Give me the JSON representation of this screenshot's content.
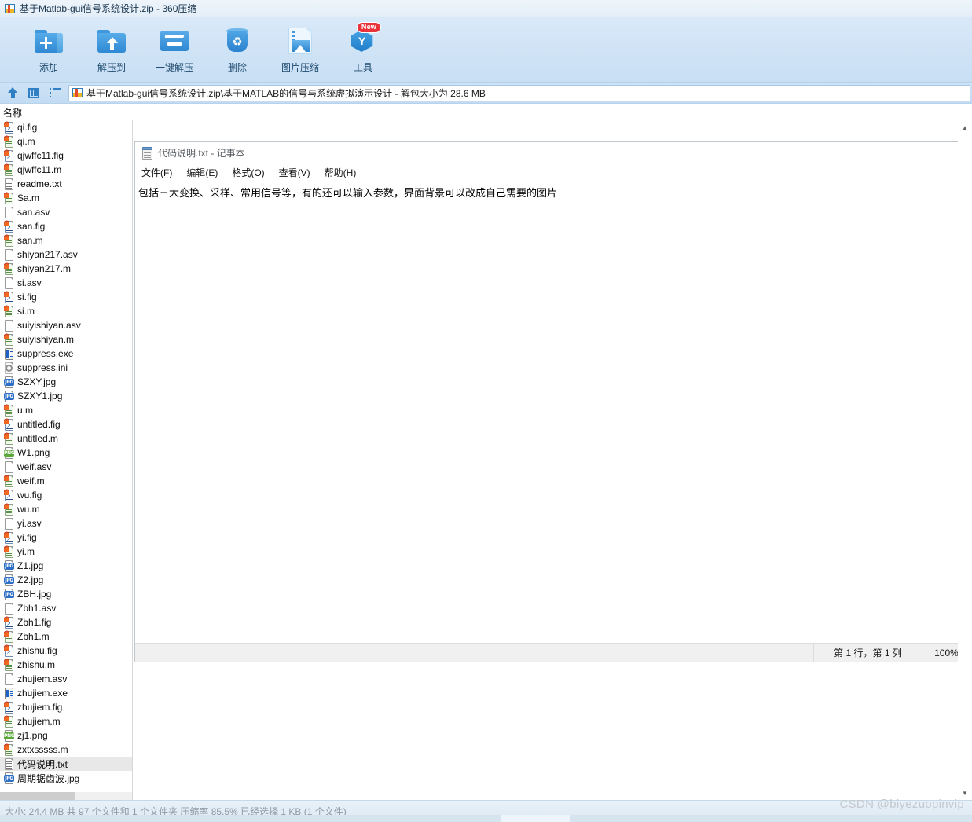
{
  "window": {
    "title": "基于Matlab-gui信号系统设计.zip - 360压缩",
    "icon": "zip-archive-icon"
  },
  "toolbar": {
    "buttons": [
      {
        "label": "添加",
        "icon": "folder-plus-icon",
        "badge": ""
      },
      {
        "label": "解压到",
        "icon": "folder-up-arrow-icon",
        "badge": ""
      },
      {
        "label": "一键解压",
        "icon": "one-click-extract-icon",
        "badge": ""
      },
      {
        "label": "删除",
        "icon": "recycle-bin-icon",
        "badge": ""
      },
      {
        "label": "图片压缩",
        "icon": "image-compress-icon",
        "badge": ""
      },
      {
        "label": "工具",
        "icon": "tools-hexagon-icon",
        "badge": "New"
      }
    ]
  },
  "addressbar": {
    "nav_icons": [
      "up-arrow-icon",
      "preview-panel-icon",
      "list-view-icon"
    ],
    "path": "基于Matlab-gui信号系统设计.zip\\基于MATLAB的信号与系统虚拟演示设计 - 解包大小为 28.6 MB"
  },
  "filelist": {
    "column_header": "名称",
    "items": [
      {
        "name": "qi.fig",
        "type": "fig",
        "selected": false
      },
      {
        "name": "qi.m",
        "type": "m",
        "selected": false
      },
      {
        "name": "qjwffc11.fig",
        "type": "fig",
        "selected": false
      },
      {
        "name": "qjwffc11.m",
        "type": "m",
        "selected": false
      },
      {
        "name": "readme.txt",
        "type": "txt",
        "selected": false
      },
      {
        "name": "Sa.m",
        "type": "m",
        "selected": false
      },
      {
        "name": "san.asv",
        "type": "asv",
        "selected": false
      },
      {
        "name": "san.fig",
        "type": "fig",
        "selected": false
      },
      {
        "name": "san.m",
        "type": "m",
        "selected": false
      },
      {
        "name": "shiyan217.asv",
        "type": "asv",
        "selected": false
      },
      {
        "name": "shiyan217.m",
        "type": "m",
        "selected": false
      },
      {
        "name": "si.asv",
        "type": "asv",
        "selected": false
      },
      {
        "name": "si.fig",
        "type": "fig",
        "selected": false
      },
      {
        "name": "si.m",
        "type": "m",
        "selected": false
      },
      {
        "name": "suiyishiyan.asv",
        "type": "asv",
        "selected": false
      },
      {
        "name": "suiyishiyan.m",
        "type": "m",
        "selected": false
      },
      {
        "name": "suppress.exe",
        "type": "exe",
        "selected": false
      },
      {
        "name": "suppress.ini",
        "type": "ini",
        "selected": false
      },
      {
        "name": "SZXY.jpg",
        "type": "jpg",
        "selected": false
      },
      {
        "name": "SZXY1.jpg",
        "type": "jpg",
        "selected": false
      },
      {
        "name": "u.m",
        "type": "m",
        "selected": false
      },
      {
        "name": "untitled.fig",
        "type": "fig",
        "selected": false
      },
      {
        "name": "untitled.m",
        "type": "m",
        "selected": false
      },
      {
        "name": "W1.png",
        "type": "png",
        "selected": false
      },
      {
        "name": "weif.asv",
        "type": "asv",
        "selected": false
      },
      {
        "name": "weif.m",
        "type": "m",
        "selected": false
      },
      {
        "name": "wu.fig",
        "type": "fig",
        "selected": false
      },
      {
        "name": "wu.m",
        "type": "m",
        "selected": false
      },
      {
        "name": "yi.asv",
        "type": "asv",
        "selected": false
      },
      {
        "name": "yi.fig",
        "type": "fig",
        "selected": false
      },
      {
        "name": "yi.m",
        "type": "m",
        "selected": false
      },
      {
        "name": "Z1.jpg",
        "type": "jpg",
        "selected": false
      },
      {
        "name": "Z2.jpg",
        "type": "jpg",
        "selected": false
      },
      {
        "name": "ZBH.jpg",
        "type": "jpg",
        "selected": false
      },
      {
        "name": "Zbh1.asv",
        "type": "asv",
        "selected": false
      },
      {
        "name": "Zbh1.fig",
        "type": "fig",
        "selected": false
      },
      {
        "name": "Zbh1.m",
        "type": "m",
        "selected": false
      },
      {
        "name": "zhishu.fig",
        "type": "fig",
        "selected": false
      },
      {
        "name": "zhishu.m",
        "type": "m",
        "selected": false
      },
      {
        "name": "zhujiem.asv",
        "type": "asv",
        "selected": false
      },
      {
        "name": "zhujiem.exe",
        "type": "exe",
        "selected": false
      },
      {
        "name": "zhujiem.fig",
        "type": "fig",
        "selected": false
      },
      {
        "name": "zhujiem.m",
        "type": "m",
        "selected": false
      },
      {
        "name": "zj1.png",
        "type": "png",
        "selected": false
      },
      {
        "name": "zxtxsssss.m",
        "type": "m",
        "selected": false
      },
      {
        "name": "代码说明.txt",
        "type": "txt",
        "selected": true
      },
      {
        "name": "周期锯齿波.jpg",
        "type": "jpg",
        "selected": false
      }
    ]
  },
  "notepad": {
    "title": "代码说明.txt - 记事本",
    "icon": "notepad-icon",
    "menu": [
      "文件(F)",
      "编辑(E)",
      "格式(O)",
      "查看(V)",
      "帮助(H)"
    ],
    "content_lines": [
      "包括三大变换、采样、常用信号等，有的还可以输入参数，界面背景可以改成自己需要的图片"
    ],
    "status": {
      "position": "第 1 行，第 1 列",
      "zoom": "100%"
    }
  },
  "statusbar": {
    "text": "大小: 24.4 MB 共 97 个文件和 1 个文件夹 压缩率 85.5% 已经选择 1 KB (1 个文件)"
  },
  "watermark": {
    "text": "CSDN @biyezuopinvip"
  }
}
